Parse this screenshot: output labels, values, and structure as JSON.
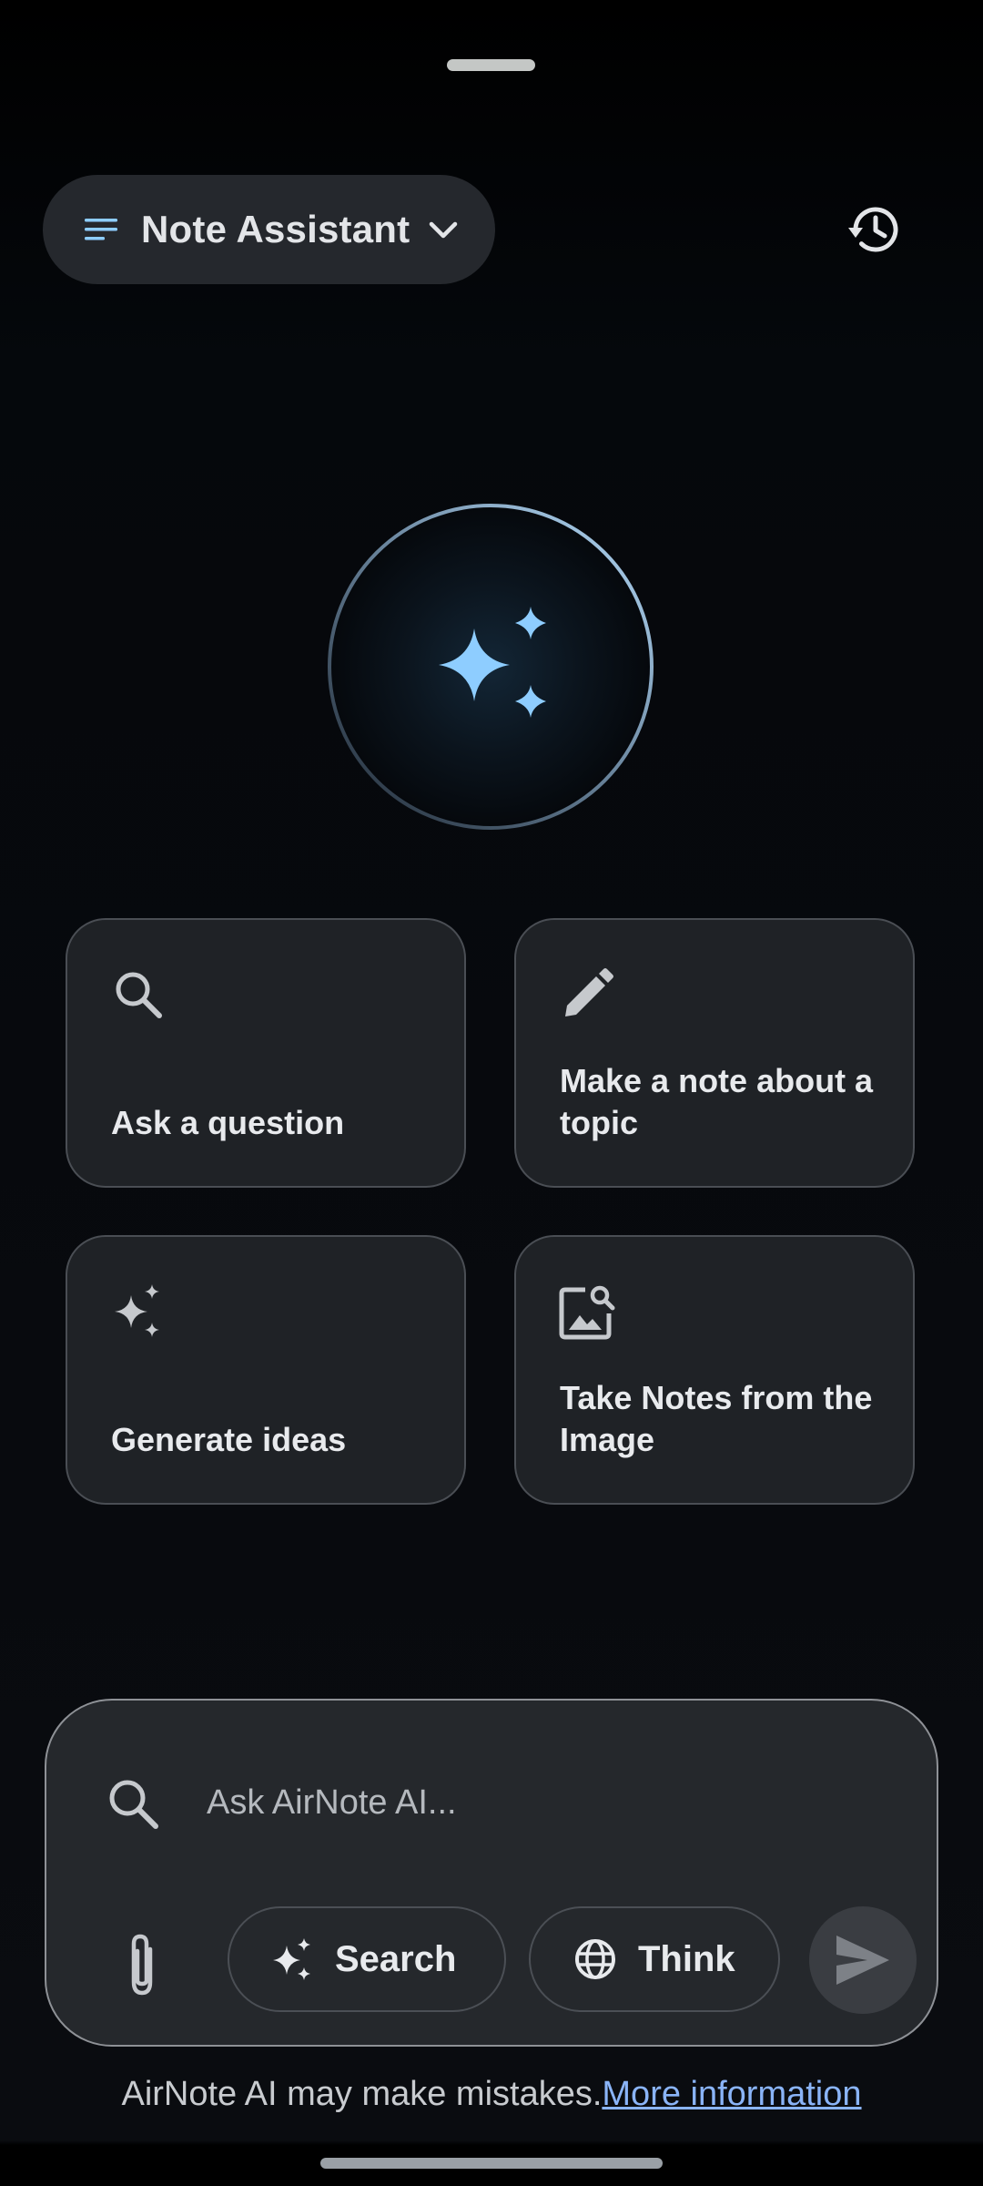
{
  "header": {
    "assistant_selector": {
      "label": "Note Assistant",
      "icon": "menu-icon",
      "chevron_icon": "chevron-down-icon"
    },
    "history_icon": "history-icon"
  },
  "hero": {
    "icon": "sparkles-icon",
    "accent": "#8ecdff"
  },
  "suggestions": [
    {
      "label": "Ask a question",
      "icon": "search-icon"
    },
    {
      "label": "Make a note about a topic",
      "icon": "pencil-icon"
    },
    {
      "label": "Generate ideas",
      "icon": "sparkles-icon"
    },
    {
      "label": "Take Notes from the Image",
      "icon": "image-search-icon"
    }
  ],
  "composer": {
    "placeholder": "Ask AirNote AI...",
    "value": "",
    "attach_icon": "paperclip-icon",
    "search_button": {
      "label": "Search",
      "icon": "sparkles-icon"
    },
    "think_button": {
      "label": "Think",
      "icon": "globe-icon"
    },
    "send_icon": "send-icon"
  },
  "footer": {
    "disclaimer": "AirNote AI may make mistakes.",
    "link": "More information",
    "link_color": "#8ab4f8"
  }
}
